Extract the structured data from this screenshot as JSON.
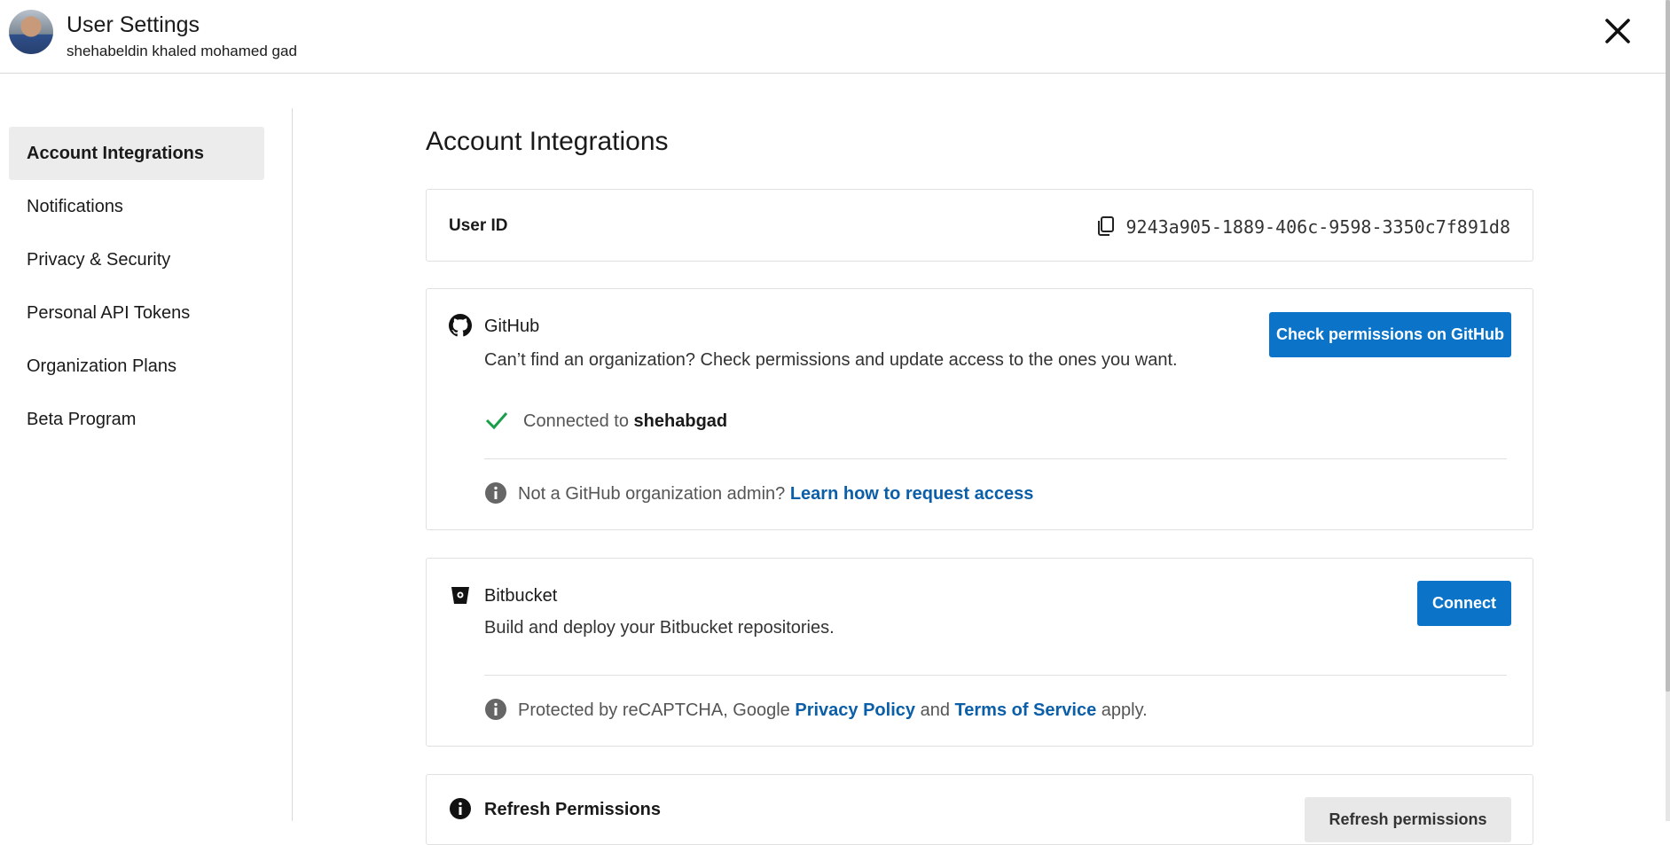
{
  "header": {
    "title": "User Settings",
    "subtitle": "shehabeldin khaled mohamed gad",
    "close_icon": "close-icon"
  },
  "sidebar": {
    "items": [
      {
        "label": "Account Integrations",
        "active": true
      },
      {
        "label": "Notifications",
        "active": false
      },
      {
        "label": "Privacy & Security",
        "active": false
      },
      {
        "label": "Personal API Tokens",
        "active": false
      },
      {
        "label": "Organization Plans",
        "active": false
      },
      {
        "label": "Beta Program",
        "active": false
      }
    ]
  },
  "main": {
    "title": "Account Integrations",
    "user_id": {
      "label": "User ID",
      "value": "9243a905-1889-406c-9598-3350c7f891d8",
      "copy_icon": "copy-icon"
    },
    "github": {
      "title": "GitHub",
      "description": "Can’t find an organization? Check permissions and update access to the ones you want.",
      "button": "Check permissions on GitHub",
      "connected_prefix": "Connected to",
      "connected_user": "shehabgad",
      "info_text": "Not a GitHub organization admin?",
      "info_link": "Learn how to request access"
    },
    "bitbucket": {
      "title": "Bitbucket",
      "description": "Build and deploy your Bitbucket repositories.",
      "button": "Connect",
      "info_prefix": "Protected by reCAPTCHA, Google",
      "privacy_link": "Privacy Policy",
      "and_text": "and",
      "terms_link": "Terms of Service",
      "info_suffix": "apply."
    },
    "refresh": {
      "title": "Refresh Permissions",
      "button": "Refresh permissions"
    }
  },
  "colors": {
    "accent": "#0b74c9",
    "link": "#0b5ea8",
    "success": "#1a9e4a",
    "active_nav_bg": "#ececec"
  }
}
